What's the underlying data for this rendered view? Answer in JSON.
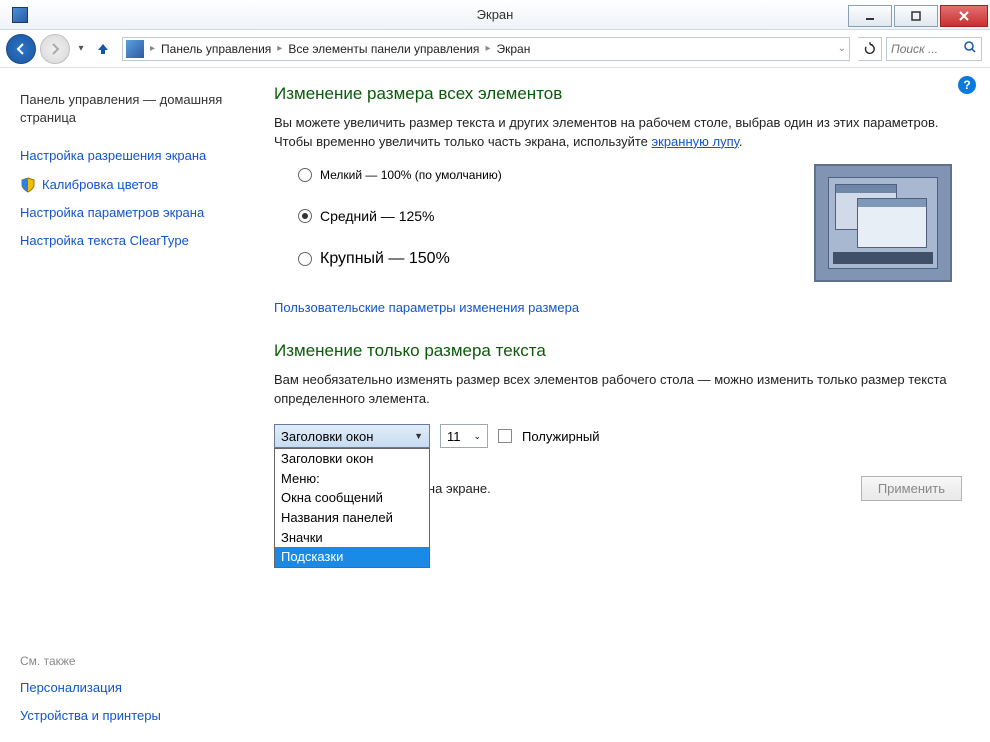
{
  "window": {
    "title": "Экран"
  },
  "breadcrumb": {
    "seg1": "Панель управления",
    "seg2": "Все элементы панели управления",
    "seg3": "Экран"
  },
  "search": {
    "placeholder": "Поиск ..."
  },
  "sidebar": {
    "home": "Панель управления — домашняя страница",
    "links": {
      "resolution": "Настройка разрешения экрана",
      "calibration": "Калибровка цветов",
      "params": "Настройка параметров экрана",
      "cleartype": "Настройка текста ClearType"
    },
    "see_also_heading": "См. также",
    "see_also": {
      "personalization": "Персонализация",
      "devices": "Устройства и принтеры"
    }
  },
  "main": {
    "heading1": "Изменение размера всех элементов",
    "desc1_a": "Вы можете увеличить размер текста и других элементов на рабочем столе, выбрав один из этих параметров. Чтобы временно увеличить только часть экрана, используйте ",
    "desc1_link": "экранную лупу",
    "desc1_b": ".",
    "radio": {
      "small": "Мелкий — 100% (по умолчанию)",
      "medium": "Средний — 125%",
      "large": "Крупный — 150%"
    },
    "custom_link": "Пользовательские параметры изменения размера",
    "heading2": "Изменение только размера текста",
    "desc2": "Вам необязательно изменять размер всех элементов рабочего стола — можно изменить только размер текста определенного элемента.",
    "element_select": "Заголовки окон",
    "font_size": "11",
    "bold_label": "Полужирный",
    "dropdown_options": {
      "o1": "Заголовки окон",
      "o2": "Меню:",
      "o3": "Окна сообщений",
      "o4": "Названия панелей",
      "o5": "Значки",
      "o6": "Подсказки"
    },
    "note_visible": "ты могут не поместиться на экране.",
    "apply": "Применить"
  }
}
